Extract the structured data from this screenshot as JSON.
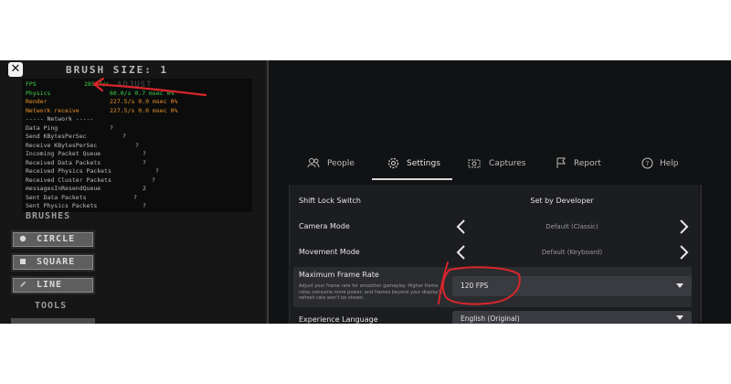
{
  "left": {
    "close_label": "✕",
    "brush_size": "BRUSH SIZE: 1",
    "ghost_text": "ADJUST",
    "stats": [
      {
        "label": "FPS",
        "value": "285.7/s",
        "cls": "green"
      },
      {
        "label": "Physics",
        "value": "60.0/s 0.7 msec 0%",
        "cls": "green"
      },
      {
        "label": "Render",
        "value": "227.5/s 0.0 msec 0%",
        "cls": "orange"
      },
      {
        "label": "Network receive",
        "value": "227.5/s 0.0 msec 0%",
        "cls": "orange"
      },
      {
        "label": "----- Network -----",
        "value": "",
        "cls": ""
      },
      {
        "label": "Data Ping",
        "value": "?",
        "cls": ""
      },
      {
        "label": "Send KBytesPerSec",
        "value": "?",
        "cls": ""
      },
      {
        "label": "Receive KBytesPerSec",
        "value": "?",
        "cls": ""
      },
      {
        "label": "Incoming Packet Queue",
        "value": "?",
        "cls": ""
      },
      {
        "label": "Received Data Packets",
        "value": "?",
        "cls": ""
      },
      {
        "label": "Received Physics Packets",
        "value": "?",
        "cls": ""
      },
      {
        "label": "Received Cluster Packets",
        "value": "?",
        "cls": ""
      },
      {
        "label": "messagesInResendQueue",
        "value": "2",
        "cls": ""
      },
      {
        "label": "Sent Data Packets",
        "value": "?",
        "cls": ""
      },
      {
        "label": "Sent Physics Packets",
        "value": "?",
        "cls": ""
      }
    ],
    "brushes_title": "BRUSHES",
    "brushes": [
      {
        "label": "CIRCLE",
        "icon": "circle-icon"
      },
      {
        "label": "SQUARE",
        "icon": "square-icon"
      },
      {
        "label": "LINE",
        "icon": "pencil-icon"
      }
    ],
    "tools_title": "TOOLS"
  },
  "tabs": [
    {
      "label": "People",
      "icon": "people-icon"
    },
    {
      "label": "Settings",
      "icon": "gear-icon"
    },
    {
      "label": "Captures",
      "icon": "camera-icon"
    },
    {
      "label": "Report",
      "icon": "flag-icon"
    },
    {
      "label": "Help",
      "icon": "help-icon"
    }
  ],
  "settings": {
    "shift_lock": {
      "label": "Shift Lock Switch",
      "value": "Set by Developer"
    },
    "camera_mode": {
      "label": "Camera Mode",
      "value": "Default (Classic)"
    },
    "movement_mode": {
      "label": "Movement Mode",
      "value": "Default (Keyboard)"
    },
    "max_frame_rate": {
      "label": "Maximum Frame Rate",
      "description": "Adjust your frame rate for smoother gameplay. Higher frame rates consume more power, and frames beyond your display's refresh rate won't be shown.",
      "value": "120 FPS"
    },
    "language": {
      "label": "Experience Language",
      "value": "English (Original)"
    }
  },
  "colors": {
    "annotation": "#d8262b",
    "fps_green": "#3fd24a",
    "stat_orange": "#e8902a"
  }
}
